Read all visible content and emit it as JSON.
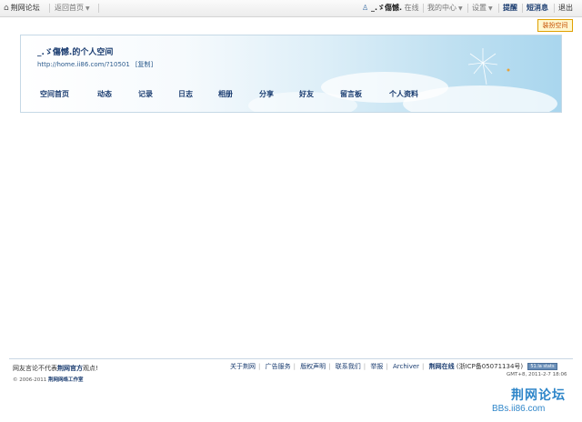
{
  "topbar": {
    "site_name": "荆网论坛",
    "back_home": "返回首页",
    "username": "_.ゞ傷憾.",
    "status": "在线",
    "my_center": "我的中心",
    "settings": "设置",
    "remind": "提醒",
    "messages": "短消息",
    "logout": "退出"
  },
  "skin_button": "装扮空间",
  "banner": {
    "title": "_.ゞ傷憾.的个人空间",
    "url": "http://home.ii86.com/?10501",
    "copy": "[复制]"
  },
  "nav": [
    "空间首页",
    "动态",
    "记录",
    "日志",
    "相册",
    "分享",
    "好友",
    "留言板",
    "个人资料"
  ],
  "footer": {
    "disclaimer_prefix": "网友言论不代表",
    "disclaimer_bold": "荆网官方",
    "disclaimer_suffix": "观点!",
    "copyright_prefix": "© 2006-2011",
    "copyright_bold": "荆网网络工作室",
    "links": [
      "关于荆网",
      "广告服务",
      "版权声明",
      "联系我们",
      "举报",
      "Archiver"
    ],
    "online": "荆网在线",
    "icp": "(浙ICP备05071134号)",
    "badge": "51.la stats",
    "time": "GMT+8, 2011-2-7 18:06"
  },
  "watermark": {
    "cn": "荆网论坛",
    "url_pre": "BBs",
    "url_dot": ".",
    "url_post": "ii86.com"
  }
}
